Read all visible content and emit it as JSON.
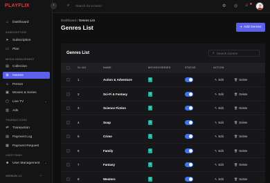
{
  "brand": {
    "logo": "PLAYFLIX",
    "accent": "#5b61ea",
    "logo_color": "#e53935"
  },
  "topbar": {
    "search_placeholder": "Search for a menu",
    "icons": [
      "search-icon",
      "gear-icon",
      "help-icon",
      "bell-icon",
      "avatar"
    ]
  },
  "sidebar": {
    "dashboard": "Dashboard",
    "section_subscription": "SUBSCRIPTION",
    "subscription": "Subscription",
    "plan": "Plan",
    "section_media": "MEDIA MANAGEMENT",
    "collection": "Collection",
    "genres": "Genres",
    "person": "Person",
    "movies_series": "Movies & Series",
    "live_tv": "Live TV",
    "ads": "Ads",
    "section_transactions": "TRANSACTIONS",
    "transaction": "Transaction",
    "payment_log": "Payment Log",
    "payment_request": "Payment Request",
    "section_user_panel": "USER PANEL",
    "user_management": "User Management",
    "version": "VERSION 1.0"
  },
  "breadcrumb": {
    "root": "Dashboard",
    "sep": "/",
    "current": "Genres List"
  },
  "page": {
    "title": "Genres List",
    "add_button": "Add Genres"
  },
  "card": {
    "title": "Genres List",
    "search_placeholder": "Search Genres",
    "columns": {
      "sl_no": "SL NO",
      "name": "NAME",
      "movies_series": "MOVIES/SERIES",
      "status": "STATUS",
      "action": "ACTION"
    },
    "edit_label": "Edit",
    "delete_label": "Delete",
    "movies_badge": "C",
    "rows": [
      {
        "sl": "1",
        "name": "Action & Adventure"
      },
      {
        "sl": "2",
        "name": "Sci-Fi & Fantasy"
      },
      {
        "sl": "3",
        "name": "Science Fiction"
      },
      {
        "sl": "4",
        "name": "Soap"
      },
      {
        "sl": "5",
        "name": "Crime"
      },
      {
        "sl": "6",
        "name": "Family"
      },
      {
        "sl": "7",
        "name": "Fantasy"
      },
      {
        "sl": "8",
        "name": "Western"
      }
    ]
  }
}
